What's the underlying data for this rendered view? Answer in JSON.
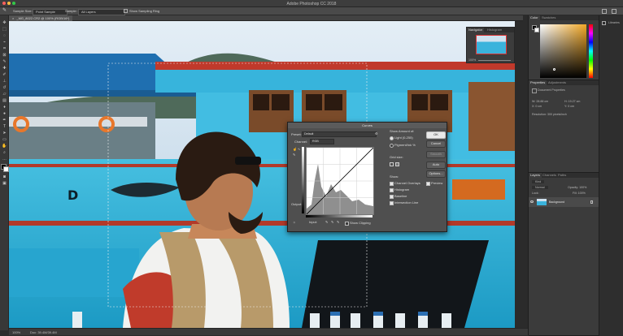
{
  "app": {
    "title": "Adobe Photoshop CC 2018"
  },
  "options_bar": {
    "tool_icon": "eyedropper-icon",
    "sample_size_label": "Sample Size:",
    "sample_size_value": "Point Sample",
    "sample_label": "Sample:",
    "sample_value": "All Layers",
    "show_ring_label": "Show Sampling Ring"
  },
  "document": {
    "tab_label": "_MG_8022.CR2 @ 100% (RGB/16*)",
    "tab_close": "×",
    "status_zoom": "100%",
    "status_doc": "Doc: 39.4M/39.4M"
  },
  "navigator": {
    "tabs": [
      "Navigator",
      "Histogram"
    ],
    "zoom_value": "100%"
  },
  "color_panel": {
    "tabs": [
      "Color",
      "Swatches"
    ],
    "accent": "#f2a825"
  },
  "properties_panel": {
    "tabs": [
      "Properties",
      "Adjustments"
    ],
    "section": "Document Properties",
    "width": "W: 28.88 cm",
    "height": "H: 19.27 cm",
    "x": "X: 0 cm",
    "y": "Y: 0 cm",
    "resolution": "Resolution: 300 pixels/inch"
  },
  "layers_panel": {
    "tabs": [
      "Layers",
      "Channels",
      "Paths"
    ],
    "kind_label": "Kind",
    "blend_mode": "Normal",
    "opacity": "Opacity: 100%",
    "lock_label": "Lock:",
    "fill": "Fill: 100%",
    "layer_name": "Background"
  },
  "libraries": {
    "label": "Libraries"
  },
  "curves": {
    "title": "Curves",
    "preset_label": "Preset:",
    "preset_value": "Default",
    "channel_label": "Channel:",
    "channel_value": "RGB",
    "input_label": "Input:",
    "output_label": "Output:",
    "show_clipping": "Show Clipping",
    "show_amount_label": "Show Amount of:",
    "light_label": "Light (0-255)",
    "pigment_label": "Pigment/Ink %",
    "grid_size_label": "Grid size:",
    "show_label": "Show:",
    "channel_overlays": "Channel Overlays",
    "histogram": "Histogram",
    "baseline": "Baseline",
    "intersection_line": "Intersection Line",
    "buttons": {
      "ok": "OK",
      "cancel": "Cancel",
      "smooth": "Smooth",
      "auto": "Auto",
      "options": "Options...",
      "preview": "Preview"
    }
  }
}
